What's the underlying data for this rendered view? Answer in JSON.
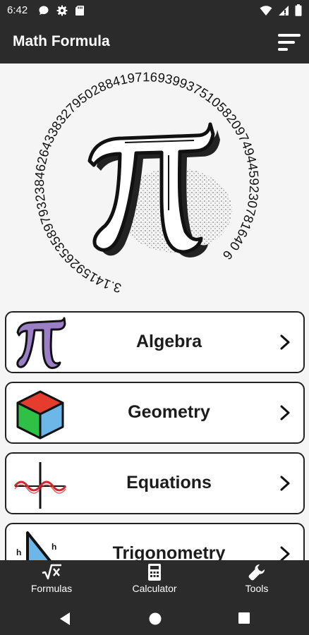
{
  "status_bar": {
    "time": "6:42",
    "left_icons": [
      "chat-icon",
      "settings-icon",
      "sd-card-icon"
    ],
    "right_icons": [
      "wifi-icon",
      "signal-icon",
      "battery-icon"
    ]
  },
  "app_bar": {
    "title": "Math Formula",
    "menu_icon": "sort-menu-icon"
  },
  "hero": {
    "pi_digits_text": "3.14159265358979323846264338327950288419716939937510582097494459230781640 6"
  },
  "categories": [
    {
      "label": "Algebra",
      "icon": "pi-icon"
    },
    {
      "label": "Geometry",
      "icon": "cube-icon"
    },
    {
      "label": "Equations",
      "icon": "wave-graph-icon"
    },
    {
      "label": "Trigonometry",
      "icon": "triangle-icon"
    }
  ],
  "bottom_nav": {
    "items": [
      {
        "label": "Formulas",
        "icon": "sqrt-icon"
      },
      {
        "label": "Calculator",
        "icon": "calculator-icon"
      },
      {
        "label": "Tools",
        "icon": "wrench-icon"
      }
    ]
  },
  "system_nav": [
    "back-icon",
    "home-icon",
    "recents-icon"
  ],
  "colors": {
    "app_bar": "#2b2b2b",
    "background": "#f5f5f5",
    "algebra_pi": "#9b7fc6",
    "cube_top": "#e63c2e",
    "cube_left": "#2fc145",
    "cube_right": "#6cb6e8",
    "wave": "#d2262c"
  }
}
